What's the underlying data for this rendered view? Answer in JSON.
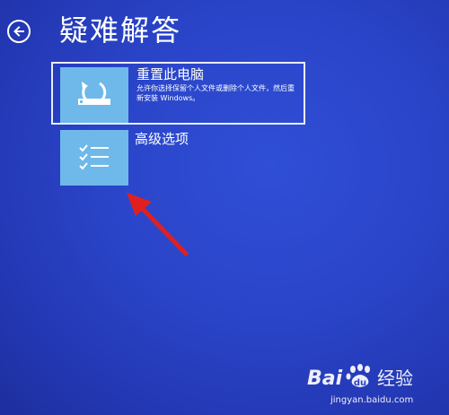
{
  "page": {
    "title": "疑难解答",
    "back_icon": "back-arrow-icon"
  },
  "options": [
    {
      "title": "重置此电脑",
      "description": "允许你选择保留个人文件或删除个人文件，然后重新安装 Windows。",
      "icon": "reset-pc-icon",
      "selected": true
    },
    {
      "title": "高级选项",
      "icon": "checklist-icon",
      "selected": false
    }
  ],
  "annotation": {
    "arrow_color": "#e02020"
  },
  "watermark": {
    "logo_text": "Bai百经验",
    "url": "jingyan.baidu.com"
  },
  "colors": {
    "background": "#2a44c8",
    "tile": "#6fb8ea",
    "text": "#ffffff"
  }
}
